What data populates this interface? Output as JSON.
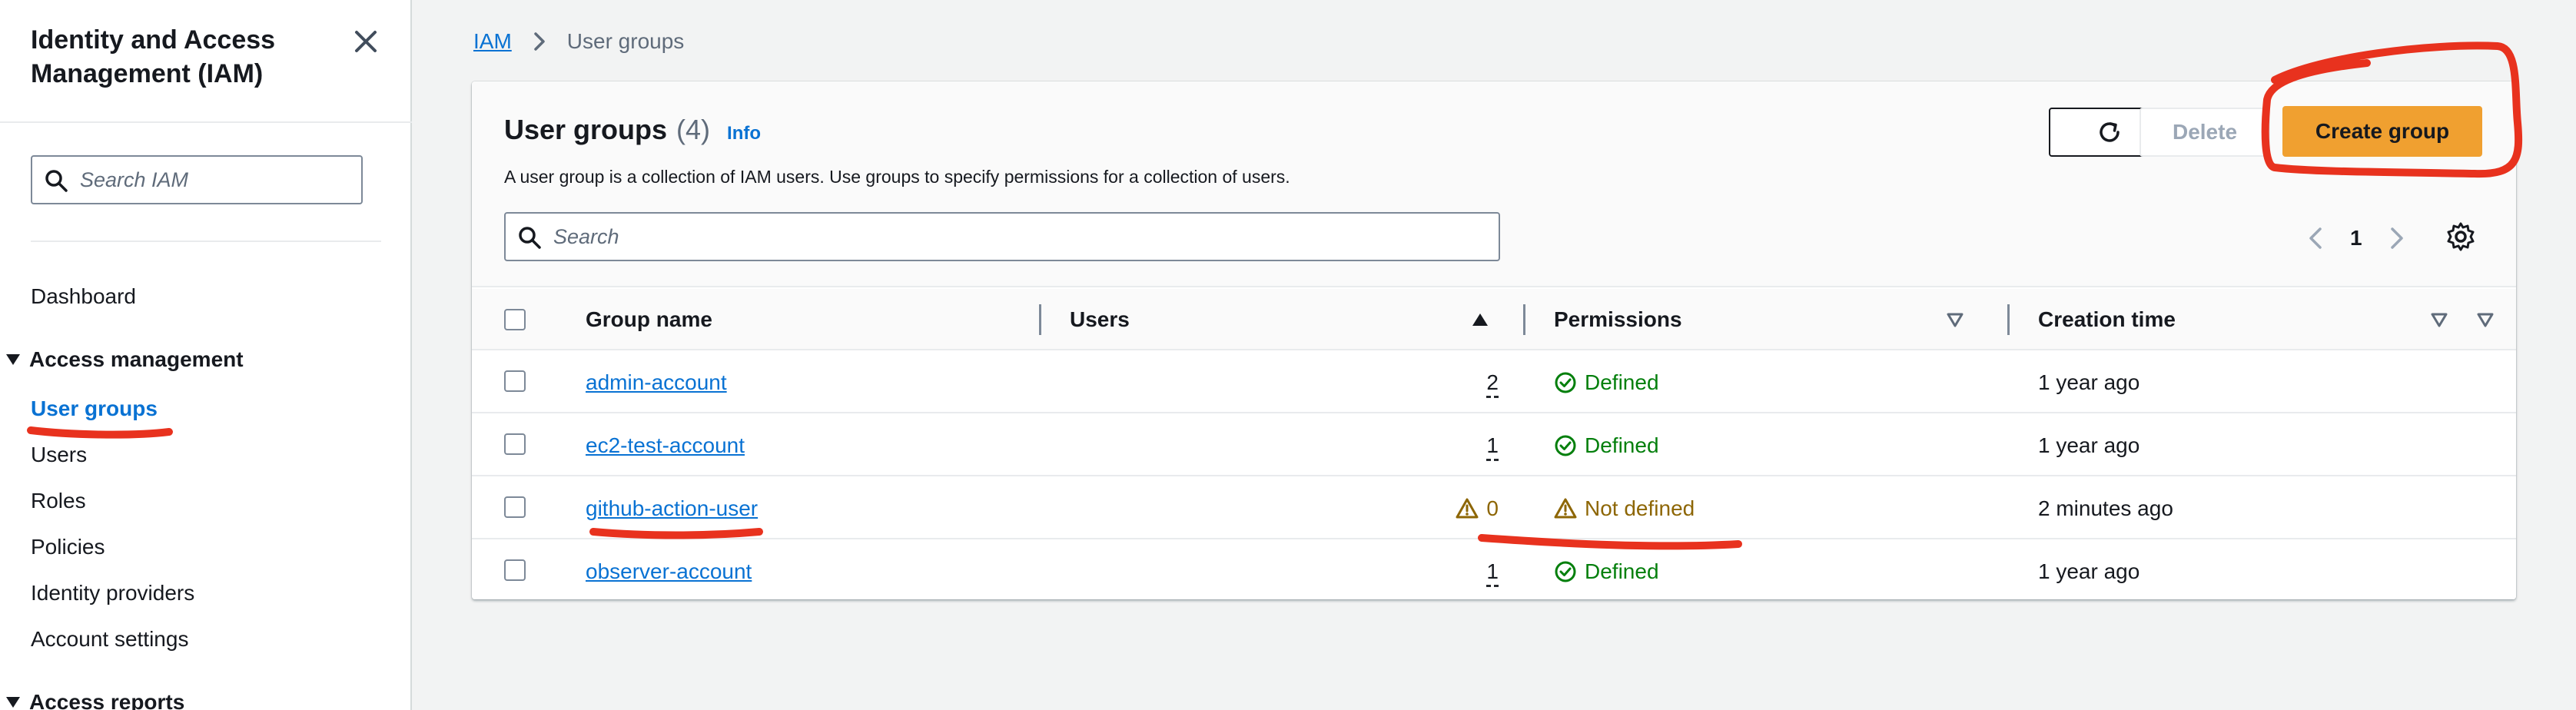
{
  "sidebar": {
    "title": "Identity and Access Management (IAM)",
    "search_placeholder": "Search IAM",
    "dashboard": "Dashboard",
    "sections": [
      {
        "label": "Access management",
        "items": [
          "User groups",
          "Users",
          "Roles",
          "Policies",
          "Identity providers",
          "Account settings"
        ]
      },
      {
        "label": "Access reports"
      }
    ],
    "active_item": "User groups"
  },
  "breadcrumb": {
    "root": "IAM",
    "current": "User groups"
  },
  "panel": {
    "title": "User groups",
    "count": "(4)",
    "info": "Info",
    "description": "A user group is a collection of IAM users. Use groups to specify permissions for a collection of users.",
    "delete_label": "Delete",
    "create_label": "Create group",
    "search_placeholder": "Search",
    "page": "1"
  },
  "table": {
    "columns": [
      "Group name",
      "Users",
      "Permissions",
      "Creation time"
    ],
    "rows": [
      {
        "name": "admin-account",
        "users": "2",
        "permissions": "Defined",
        "status": "ok",
        "created": "1 year ago"
      },
      {
        "name": "ec2-test-account",
        "users": "1",
        "permissions": "Defined",
        "status": "ok",
        "created": "1 year ago"
      },
      {
        "name": "github-action-user",
        "users": "0",
        "permissions": "Not defined",
        "status": "warn",
        "created": "2 minutes ago"
      },
      {
        "name": "observer-account",
        "users": "1",
        "permissions": "Defined",
        "status": "ok",
        "created": "1 year ago"
      }
    ]
  },
  "colors": {
    "accent": "#0972d3",
    "primary_button": "#f0a030",
    "success": "#037f0c",
    "warning": "#8d6605",
    "annotation": "#e8321e"
  },
  "icons": [
    "close-icon",
    "search-icon",
    "chevron-right-icon",
    "refresh-icon",
    "chevron-left-icon",
    "gear-icon",
    "sort-ascending-icon",
    "sort-icon",
    "check-circle-icon",
    "warning-icon",
    "caret-down-icon"
  ]
}
